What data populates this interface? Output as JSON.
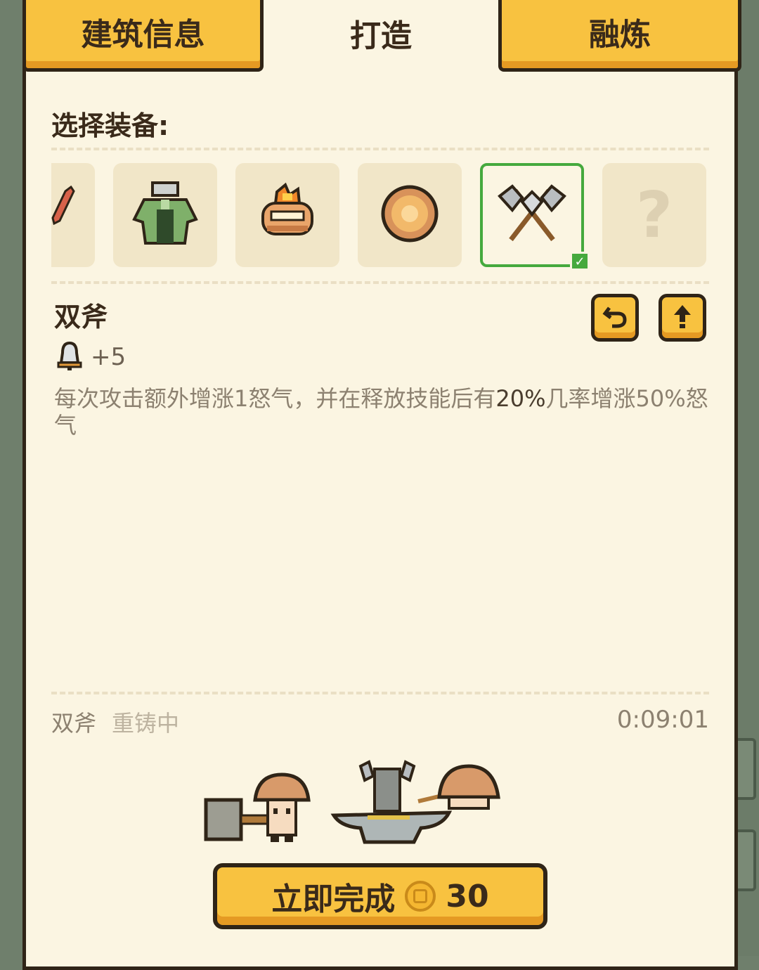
{
  "tabs": [
    {
      "label": "建筑信息",
      "active": false
    },
    {
      "label": "打造",
      "active": true
    },
    {
      "label": "融炼",
      "active": false
    }
  ],
  "equipment": {
    "section_title": "选择装备:",
    "slots": [
      {
        "icon": "red-feather-icon"
      },
      {
        "icon": "green-robe-icon"
      },
      {
        "icon": "flame-bowl-icon"
      },
      {
        "icon": "bronze-shield-icon"
      },
      {
        "icon": "double-axe-icon",
        "selected": true
      },
      {
        "icon": "question-mark-icon",
        "label": "?"
      }
    ]
  },
  "item": {
    "name": "双斧",
    "stat_icon": "bell-icon",
    "stat_value": "+5",
    "description_part1": "每次攻击额外增涨1怒气，并在释放技能后有",
    "description_highlight": "20%",
    "description_part2": "几率增涨50%怒气"
  },
  "forging": {
    "item_name": "双斧",
    "state": "重铸中",
    "timer": "0:09:01"
  },
  "complete_button": {
    "label": "立即完成",
    "cost": "30",
    "currency_icon": "gold-coin-icon"
  },
  "colors": {
    "panel_bg": "#fbf5e2",
    "tab_yellow": "#f8c240",
    "selected_border": "#45a93d",
    "outline": "#2f2417"
  }
}
